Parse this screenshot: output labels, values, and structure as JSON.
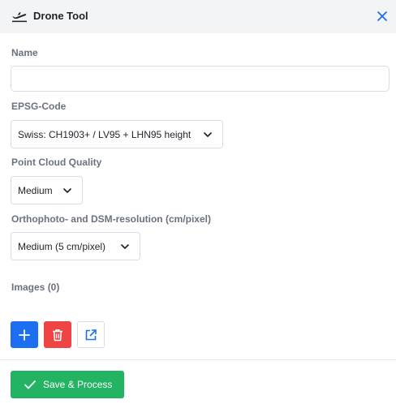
{
  "header": {
    "title": "Drone Tool",
    "drone_icon": "airplane-takeoff-icon",
    "close_icon": "close-icon",
    "accent": "#1d6ff2"
  },
  "form": {
    "name": {
      "label": "Name",
      "value": "",
      "placeholder": ""
    },
    "epsg": {
      "label": "EPSG-Code",
      "selected": "Swiss: CH1903+ / LV95 + LHN95 height"
    },
    "point_cloud": {
      "label": "Point Cloud Quality",
      "selected": "Medium"
    },
    "ortho": {
      "label": "Orthophoto- and DSM-resolution (cm/pixel)",
      "selected": "Medium (5 cm/pixel)"
    },
    "images": {
      "label": "Images (0)"
    }
  },
  "image_actions": {
    "add_icon": "plus-icon",
    "delete_icon": "trash-icon",
    "open_icon": "external-link-icon",
    "add_color": "#1d6ff2",
    "delete_color": "#ef4444"
  },
  "footer": {
    "save_label": "Save & Process",
    "save_icon": "check-icon",
    "save_color": "#22b462"
  }
}
